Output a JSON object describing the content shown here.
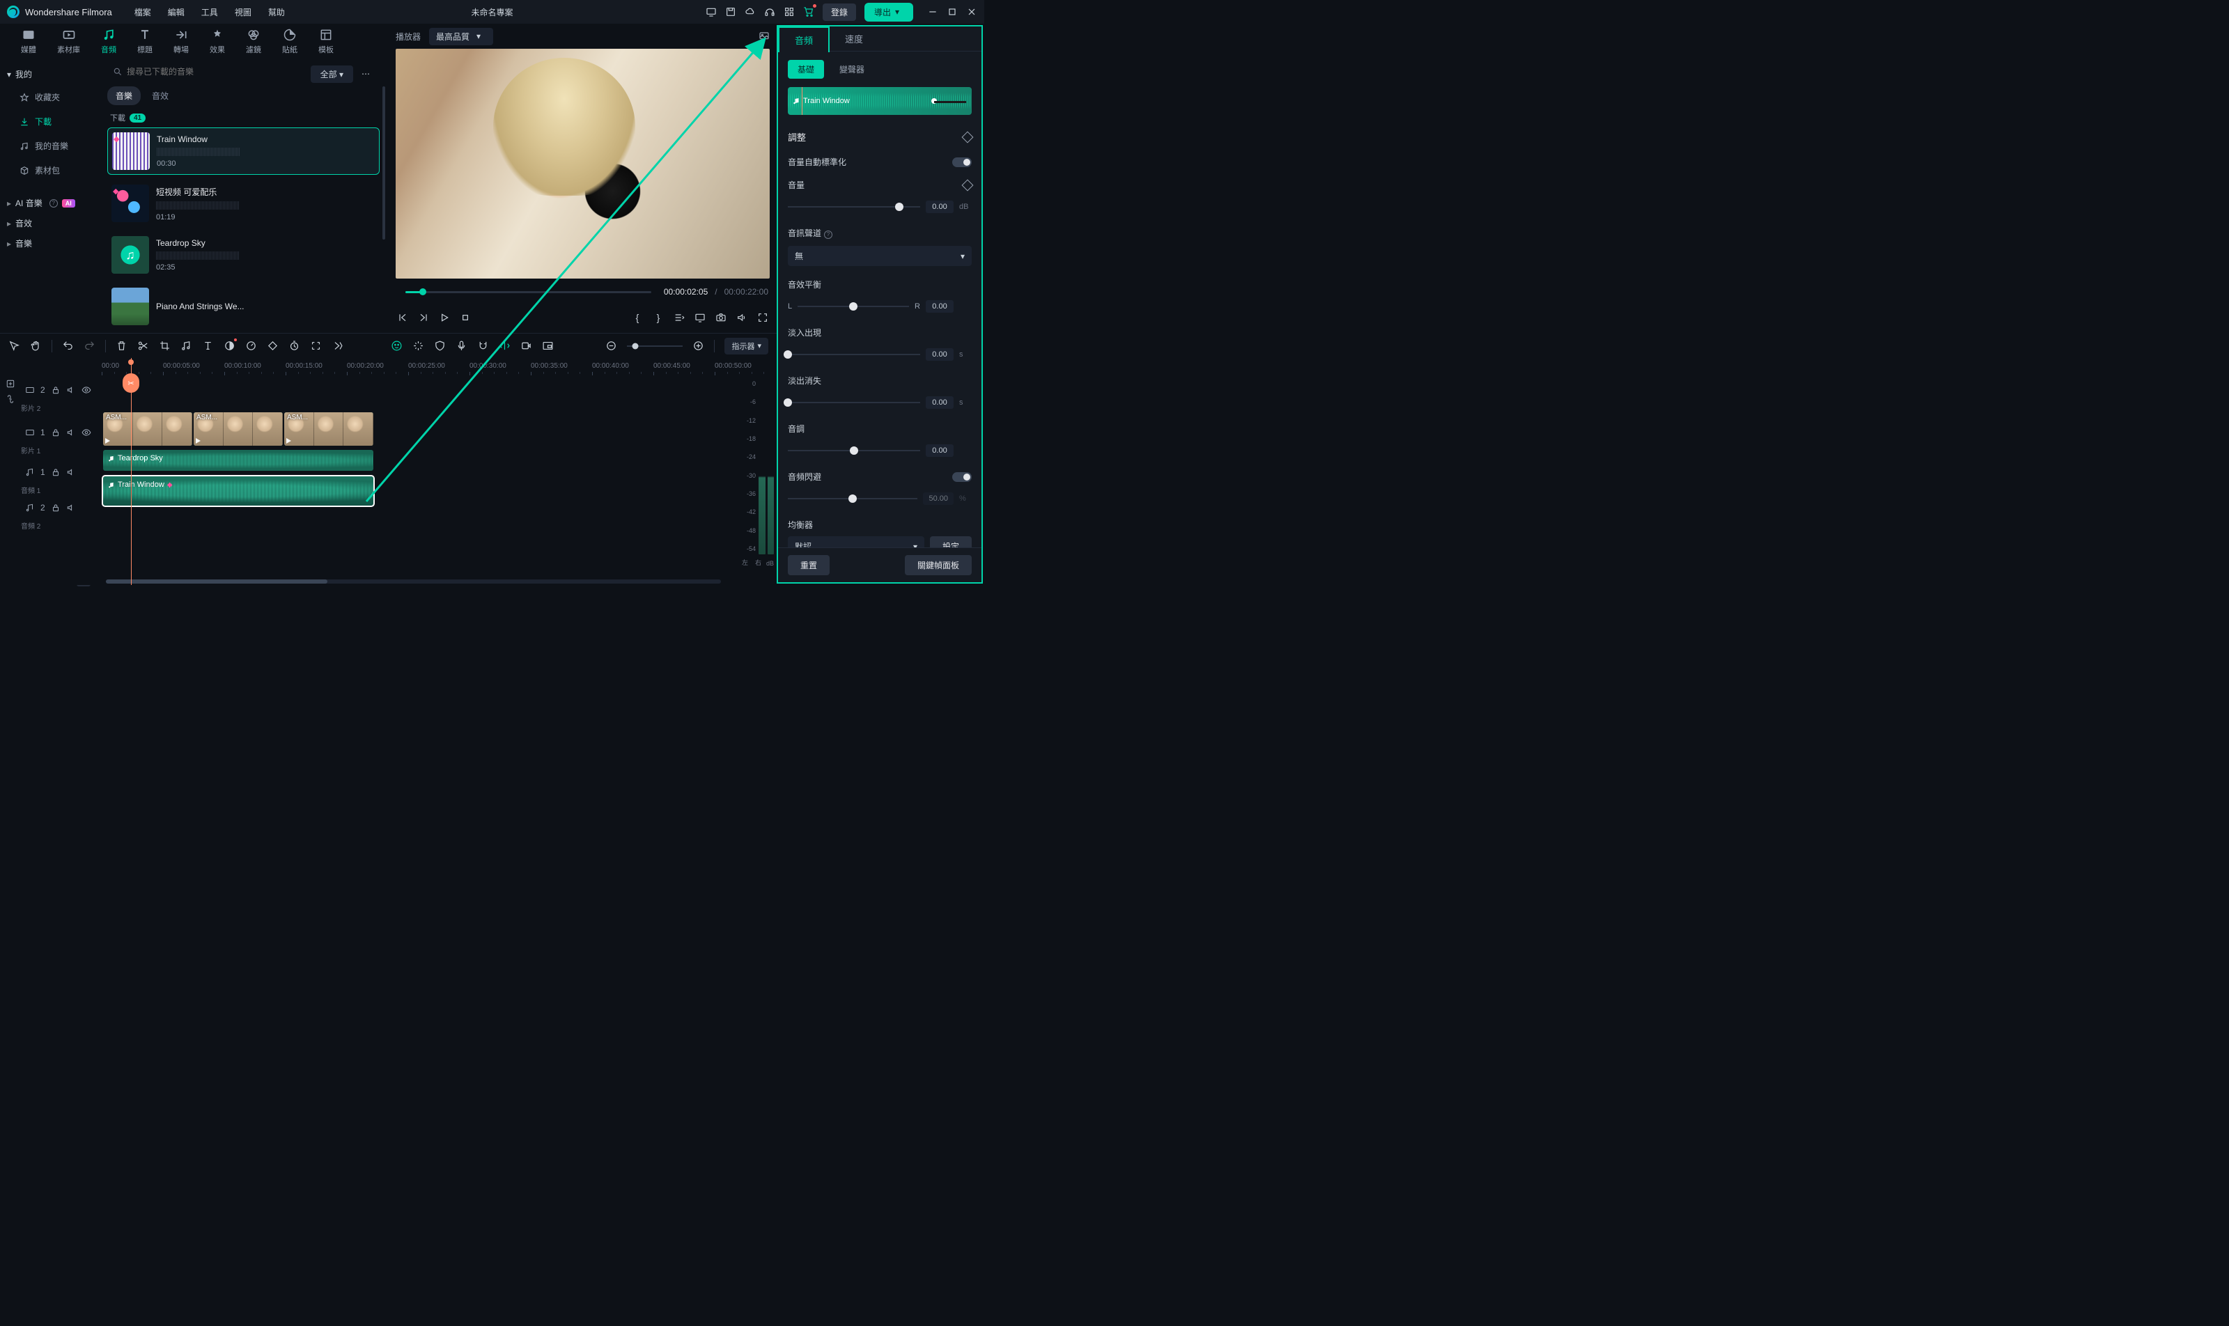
{
  "app": {
    "title": "Wondershare Filmora",
    "project": "未命名專案"
  },
  "menu": [
    "檔案",
    "編輯",
    "工具",
    "視圖",
    "幫助"
  ],
  "login": "登錄",
  "export": "導出",
  "toptabs": [
    {
      "id": "media",
      "label": "媒體"
    },
    {
      "id": "stock",
      "label": "素材庫"
    },
    {
      "id": "audio",
      "label": "音頻",
      "active": true
    },
    {
      "id": "titles",
      "label": "標題"
    },
    {
      "id": "trans",
      "label": "轉場"
    },
    {
      "id": "effects",
      "label": "效果"
    },
    {
      "id": "filters",
      "label": "濾鏡"
    },
    {
      "id": "stickers",
      "label": "貼紙"
    },
    {
      "id": "templates",
      "label": "模板"
    }
  ],
  "search": {
    "placeholder": "搜尋已下載的音樂"
  },
  "allfilter": "全部",
  "tree": {
    "my": "我的",
    "items": [
      {
        "label": "收藏夾",
        "icon": "star"
      },
      {
        "label": "下載",
        "icon": "download",
        "active": true
      },
      {
        "label": "我的音樂",
        "icon": "music"
      },
      {
        "label": "素材包",
        "icon": "package"
      }
    ],
    "cats": [
      {
        "label": "AI 音樂 ",
        "ai": true,
        "help": true
      },
      {
        "label": "音效"
      },
      {
        "label": "音樂"
      }
    ]
  },
  "subtabs": [
    {
      "label": "音樂",
      "active": true
    },
    {
      "label": "音效"
    }
  ],
  "download": {
    "label": "下載",
    "count": "41"
  },
  "media": [
    {
      "title": "Train Window",
      "dur": "00:30",
      "thumb": "thumb1",
      "sel": true,
      "gem": true
    },
    {
      "title": "短视频 可爱配乐",
      "dur": "01:19",
      "thumb": "thumb2",
      "gem": true
    },
    {
      "title": "Teardrop Sky",
      "dur": "02:35",
      "thumb": "thumb3"
    },
    {
      "title": "Piano And Strings We...",
      "dur": "",
      "thumb": "thumb4"
    }
  ],
  "player": {
    "label": "播放器",
    "quality": "最高品質",
    "cur": "00:00:02:05",
    "sep": "/",
    "total": "00:00:22:00"
  },
  "brackets": {
    "open": "{",
    "close": "}"
  },
  "rpanel": {
    "tabs": [
      {
        "label": "音頻",
        "active": true
      },
      {
        "label": "速度"
      }
    ],
    "subtabs": [
      {
        "label": "基礎",
        "active": true
      },
      {
        "label": "變聲器"
      }
    ],
    "trackname": "Train Window",
    "adjust": "調整",
    "rows": {
      "autonorm": "音量自動標準化",
      "volume": "音量",
      "vol_val": "0.00",
      "vol_unit": "dB",
      "channel": "音訊聲道",
      "channel_val": "無",
      "balance": "音效平衡",
      "L": "L",
      "R": "R",
      "bal_val": "0.00",
      "fadein": "淡入出現",
      "fi_val": "0.00",
      "sec": "s",
      "fadeout": "淡出消失",
      "fo_val": "0.00",
      "pitch": "音調",
      "pitch_val": "0.00",
      "duck": "音頻閃避",
      "duck_val": "50.00",
      "duck_unit": "%",
      "eq": "均衡器",
      "eq_val": "默認",
      "eq_btn": "設定"
    },
    "reset": "重置",
    "keyframe": "關鍵幀面板"
  },
  "timeline": {
    "marker": "指示器",
    "ticks": [
      "00:00",
      "00:00:05:00",
      "00:00:10:00",
      "00:00:15:00",
      "00:00:20:00",
      "00:00:25:00",
      "00:00:30:00",
      "00:00:35:00",
      "00:00:40:00",
      "00:00:45:00",
      "00:00:50:00"
    ],
    "tracks": {
      "v2": {
        "icon": "video",
        "num": "2",
        "label": "影片 2"
      },
      "v1": {
        "icon": "video",
        "num": "1",
        "label": "影片 1"
      },
      "a1": {
        "icon": "audio",
        "num": "1",
        "label": "音頻 1"
      },
      "a2": {
        "icon": "audio",
        "num": "2",
        "label": "音頻 2"
      }
    },
    "clips": {
      "v": [
        {
          "label": "ASM...",
          "w": 130
        },
        {
          "label": "ASM...",
          "w": 130
        },
        {
          "label": "ASM...",
          "w": 130
        }
      ],
      "a1": {
        "label": "Teardrop Sky"
      },
      "a2": {
        "label": "Train Window"
      }
    },
    "meters": [
      "0",
      "-6",
      "-12",
      "-18",
      "-24",
      "-30",
      "-36",
      "-42",
      "-48",
      "-54"
    ],
    "meterfoot": {
      "l": "左",
      "r": "右",
      "db": "dB"
    }
  }
}
